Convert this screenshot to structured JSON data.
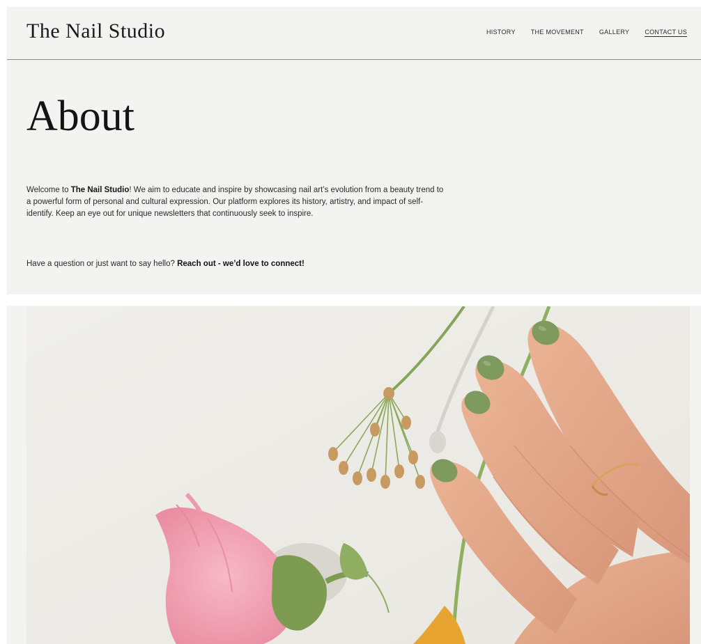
{
  "header": {
    "brand": "The Nail Studio",
    "nav": [
      {
        "label": "HISTORY",
        "active": false
      },
      {
        "label": "THE MOVEMENT",
        "active": false
      },
      {
        "label": "GALLERY",
        "active": false
      },
      {
        "label": "CONTACT US",
        "active": true
      }
    ]
  },
  "about": {
    "title": "About",
    "intro_prefix": "Welcome to ",
    "intro_brand": "The Nail Studio",
    "intro_body": "! We aim to educate and inspire by showcasing nail art’s evolution from a beauty trend to a powerful form of personal and cultural expression. Our platform explores its history, artistry, and impact of self-identify. Keep an eye out for unique newsletters that continuously seek to inspire.",
    "question": "Have a question or just want to say hello? ",
    "cta": "Reach out - we’d love to connect!"
  },
  "hero_image": {
    "subject": "hand with green nail polish beside pink and dried flowers",
    "colors": {
      "background": "#eeede8",
      "nail": "#7f9a5e",
      "skin": "#e3a988",
      "flower": "#f2a3b3",
      "stem": "#8aa95a"
    }
  }
}
